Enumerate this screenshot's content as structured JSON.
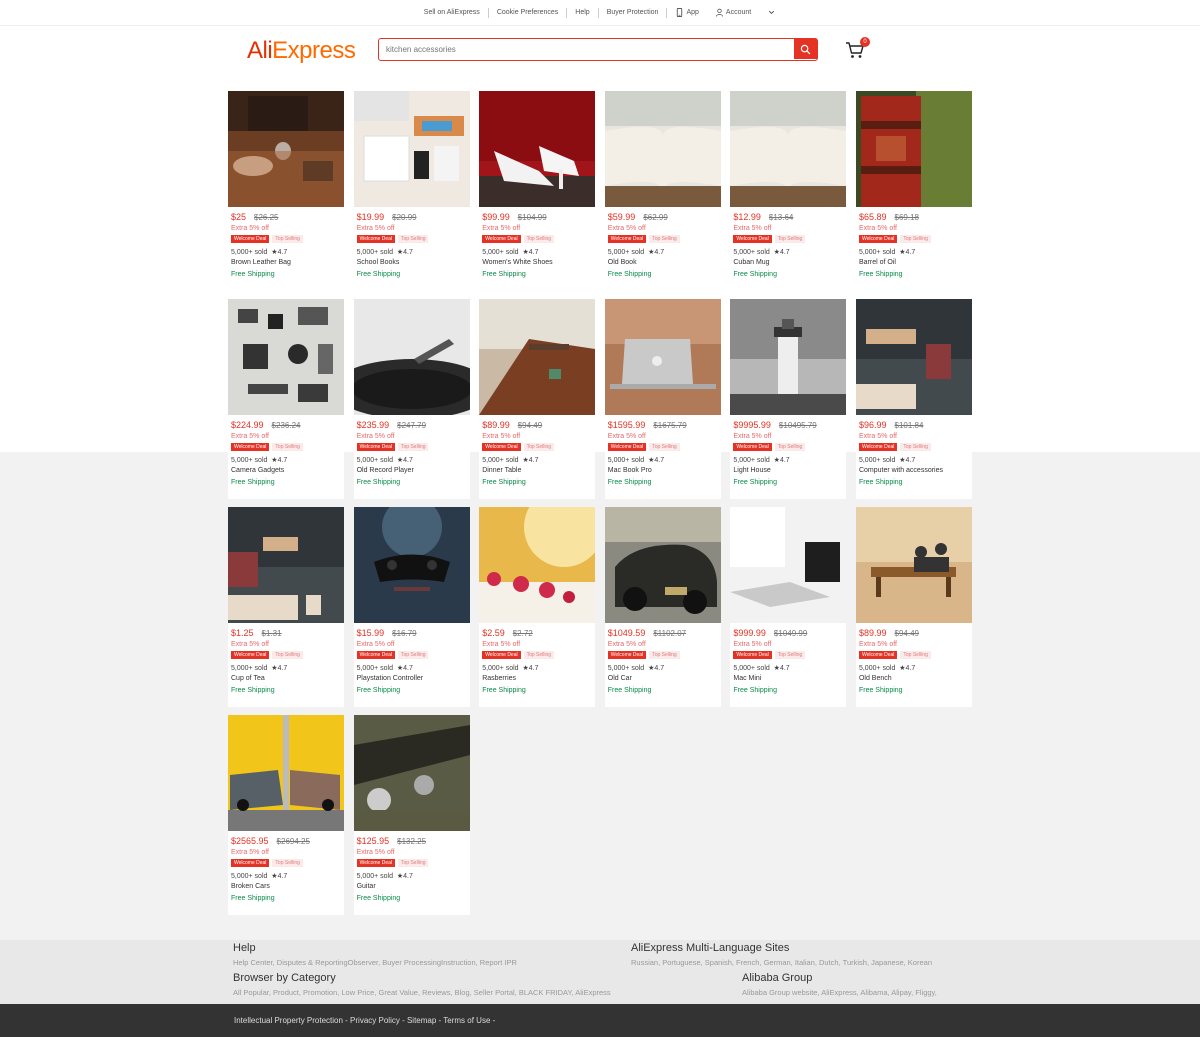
{
  "topbar": {
    "sell": "Sell on AliExpress",
    "cookie": "Cookie Preferences",
    "help": "Help",
    "buyer": "Buyer Protection",
    "app": "App",
    "account": "Account"
  },
  "header": {
    "logo_ali": "Ali",
    "logo_express": "Express",
    "search_placeholder": "kitchen accessories",
    "cart_count": "0"
  },
  "colors": {
    "accent": "#e43225",
    "shipping": "#0a8a4a"
  },
  "products": [
    {
      "price": "$25",
      "orig": "$26.25",
      "extra": "Extra 5% off",
      "deal": "Welcome Deal",
      "top": "Top Selling",
      "sold": "5,000+ sold",
      "rating": "★4.7",
      "name": "Brown Leather Bag",
      "ship": "Free Shipping"
    },
    {
      "price": "$19.99",
      "orig": "$20.99",
      "extra": "Extra 5% off",
      "deal": "Welcome Deal",
      "top": "Top Selling",
      "sold": "5,000+ sold",
      "rating": "★4.7",
      "name": "School Books",
      "ship": "Free Shipping"
    },
    {
      "price": "$99.99",
      "orig": "$104.99",
      "extra": "Extra 5% off",
      "deal": "Welcome Deal",
      "top": "Top Selling",
      "sold": "5,000+ sold",
      "rating": "★4.7",
      "name": "Women's White Shoes",
      "ship": "Free Shipping"
    },
    {
      "price": "$59.99",
      "orig": "$62.99",
      "extra": "Extra 5% off",
      "deal": "Welcome Deal",
      "top": "Top Selling",
      "sold": "5,000+ sold",
      "rating": "★4.7",
      "name": "Old Book",
      "ship": "Free Shipping"
    },
    {
      "price": "$12.99",
      "orig": "$13.64",
      "extra": "Extra 5% off",
      "deal": "Welcome Deal",
      "top": "Top Selling",
      "sold": "5,000+ sold",
      "rating": "★4.7",
      "name": "Cuban Mug",
      "ship": "Free Shipping"
    },
    {
      "price": "$65.89",
      "orig": "$69.18",
      "extra": "Extra 5% off",
      "deal": "Welcome Deal",
      "top": "Top Selling",
      "sold": "5,000+ sold",
      "rating": "★4.7",
      "name": "Barrel of Oil",
      "ship": "Free Shipping"
    },
    {
      "price": "$224.99",
      "orig": "$236.24",
      "extra": "Extra 5% off",
      "deal": "Welcome Deal",
      "top": "Top Selling",
      "sold": "5,000+ sold",
      "rating": "★4.7",
      "name": "Camera Gadgets",
      "ship": "Free Shipping"
    },
    {
      "price": "$235.99",
      "orig": "$247.79",
      "extra": "Extra 5% off",
      "deal": "Welcome Deal",
      "top": "Top Selling",
      "sold": "5,000+ sold",
      "rating": "★4.7",
      "name": "Old Record Player",
      "ship": "Free Shipping"
    },
    {
      "price": "$89.99",
      "orig": "$94.49",
      "extra": "Extra 5% off",
      "deal": "Welcome Deal",
      "top": "Top Selling",
      "sold": "5,000+ sold",
      "rating": "★4.7",
      "name": "Dinner Table",
      "ship": "Free Shipping"
    },
    {
      "price": "$1595.99",
      "orig": "$1675.79",
      "extra": "Extra 5% off",
      "deal": "Welcome Deal",
      "top": "Top Selling",
      "sold": "5,000+ sold",
      "rating": "★4.7",
      "name": "Mac Book Pro",
      "ship": "Free Shipping"
    },
    {
      "price": "$9995.99",
      "orig": "$10495.79",
      "extra": "Extra 5% off",
      "deal": "Welcome Deal",
      "top": "Top Selling",
      "sold": "5,000+ sold",
      "rating": "★4.7",
      "name": "Light House",
      "ship": "Free Shipping"
    },
    {
      "price": "$96.99",
      "orig": "$101.84",
      "extra": "Extra 5% off",
      "deal": "Welcome Deal",
      "top": "Top Selling",
      "sold": "5,000+ sold",
      "rating": "★4.7",
      "name": "Computer with accessories",
      "ship": "Free Shipping"
    },
    {
      "price": "$1.25",
      "orig": "$1.31",
      "extra": "Extra 5% off",
      "deal": "Welcome Deal",
      "top": "Top Selling",
      "sold": "5,000+ sold",
      "rating": "★4.7",
      "name": "Cup of Tea",
      "ship": "Free Shipping"
    },
    {
      "price": "$15.99",
      "orig": "$16.79",
      "extra": "Extra 5% off",
      "deal": "Welcome Deal",
      "top": "Top Selling",
      "sold": "5,000+ sold",
      "rating": "★4.7",
      "name": "Playstation Controller",
      "ship": "Free Shipping"
    },
    {
      "price": "$2.59",
      "orig": "$2.72",
      "extra": "Extra 5% off",
      "deal": "Welcome Deal",
      "top": "Top Selling",
      "sold": "5,000+ sold",
      "rating": "★4.7",
      "name": "Rasberries",
      "ship": "Free Shipping"
    },
    {
      "price": "$1049.59",
      "orig": "$1102.07",
      "extra": "Extra 5% off",
      "deal": "Welcome Deal",
      "top": "Top Selling",
      "sold": "5,000+ sold",
      "rating": "★4.7",
      "name": "Old Car",
      "ship": "Free Shipping"
    },
    {
      "price": "$999.99",
      "orig": "$1049.99",
      "extra": "Extra 5% off",
      "deal": "Welcome Deal",
      "top": "Top Selling",
      "sold": "5,000+ sold",
      "rating": "★4.7",
      "name": "Mac Mini",
      "ship": "Free Shipping"
    },
    {
      "price": "$89.99",
      "orig": "$94.49",
      "extra": "Extra 5% off",
      "deal": "Welcome Deal",
      "top": "Top Selling",
      "sold": "5,000+ sold",
      "rating": "★4.7",
      "name": "Old Bench",
      "ship": "Free Shipping"
    },
    {
      "price": "$2565.95",
      "orig": "$2694.25",
      "extra": "Extra 5% off",
      "deal": "Welcome Deal",
      "top": "Top Selling",
      "sold": "5,000+ sold",
      "rating": "★4.7",
      "name": "Broken Cars",
      "ship": "Free Shipping"
    },
    {
      "price": "$125.95",
      "orig": "$132.25",
      "extra": "Extra 5% off",
      "deal": "Welcome Deal",
      "top": "Top Selling",
      "sold": "5,000+ sold",
      "rating": "★4.7",
      "name": "Guitar",
      "ship": "Free Shipping"
    }
  ],
  "footer": {
    "help_title": "Help",
    "help_links": "Help Center, Disputes & ReportingObserver, Buyer ProcessingInstruction, Report IPR",
    "lang_title": "AliExpress Multi-Language Sites",
    "lang_links": "Russian, Portuguese, Spanish, French, German, Italian, Dutch, Turkish, Japanese, Korean",
    "browse_title": "Browser by Category",
    "browse_links": "All Popular, Product, Promotion, Low Price, Great Value, Reviews, Blog, Seller Portal, BLACK FRIDAY, AliExpress",
    "alibaba_title": "Alibaba Group",
    "alibaba_links": "Alibaba Group website, AliExpress, Alibama, Alipay, Fliggy,",
    "bottom": "Intellectual Property Protection - Privacy Policy - Sitemap - Terms of Use -"
  }
}
